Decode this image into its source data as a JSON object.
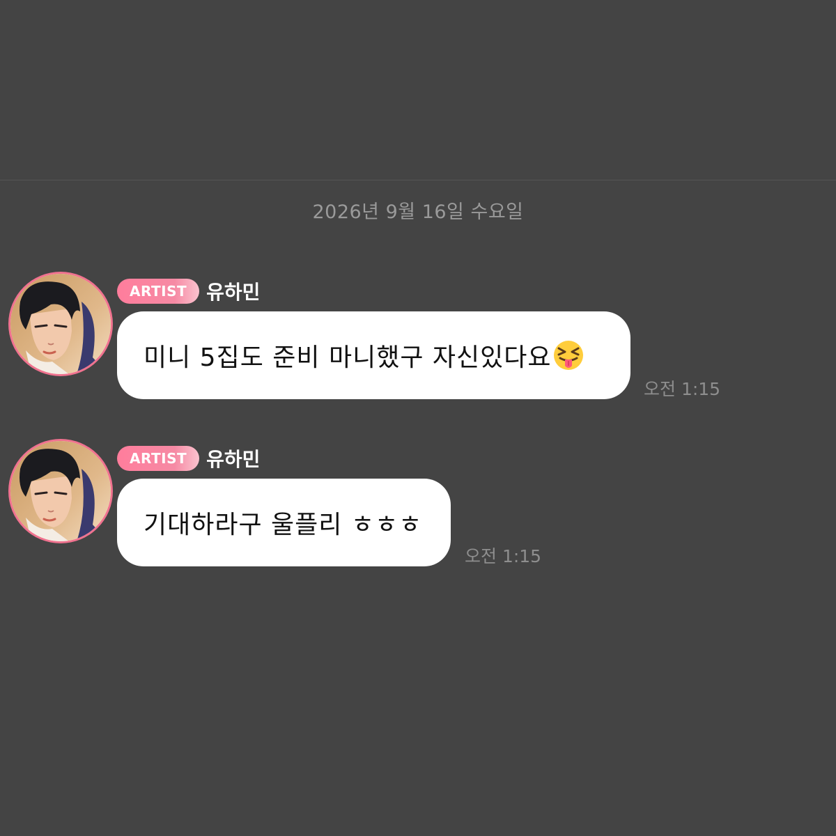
{
  "date_separator": "2026년 9월 16일 수요일",
  "messages": [
    {
      "badge": "ARTIST",
      "sender": "유하민",
      "text": "미니 5집도 준비 마니했구 자신있다요",
      "emoji": "squinting-face-with-tongue-icon",
      "time": "오전 1:15"
    },
    {
      "badge": "ARTIST",
      "sender": "유하민",
      "text": "기대하라구 울플리 ㅎㅎㅎ",
      "time": "오전 1:15"
    }
  ],
  "colors": {
    "background": "#444444",
    "badge_accent": "#ff7d9c",
    "avatar_ring": "#f0728f",
    "bubble": "#ffffff",
    "timestamp": "#8e8e8e"
  }
}
